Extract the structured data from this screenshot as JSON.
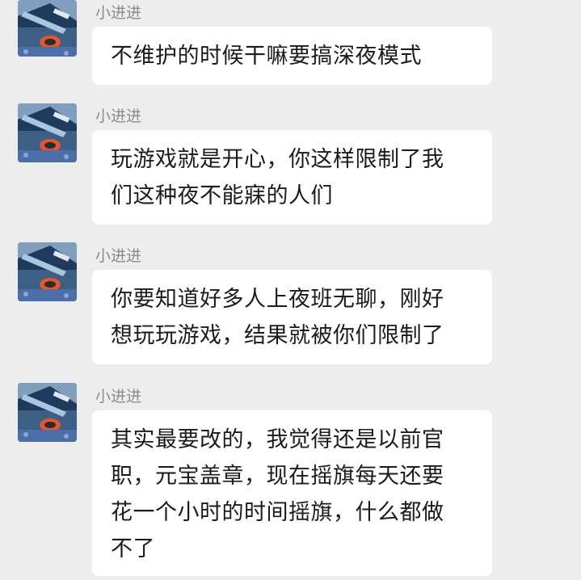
{
  "colors": {
    "background": "#ededed",
    "bubble": "#ffffff",
    "sender_name": "#8a8a8a",
    "text": "#1b1b1b"
  },
  "messages": [
    {
      "sender": "小进进",
      "avatar_icon": "user-avatar-icon",
      "lines": [
        "不维护的时候干嘛要搞深夜模式"
      ]
    },
    {
      "sender": "小进进",
      "avatar_icon": "user-avatar-icon",
      "lines": [
        "玩游戏就是开心，你这样限制了我",
        "们这种夜不能寐的人们"
      ]
    },
    {
      "sender": "小进进",
      "avatar_icon": "user-avatar-icon",
      "lines": [
        "你要知道好多人上夜班无聊，刚好",
        "想玩玩游戏，结果就被你们限制了"
      ]
    },
    {
      "sender": "小进进",
      "avatar_icon": "user-avatar-icon",
      "lines": [
        "其实最要改的，我觉得还是以前官",
        "职，元宝盖章，现在摇旗每天还要",
        "花一个小时的时间摇旗，什么都做",
        "不了"
      ]
    }
  ]
}
